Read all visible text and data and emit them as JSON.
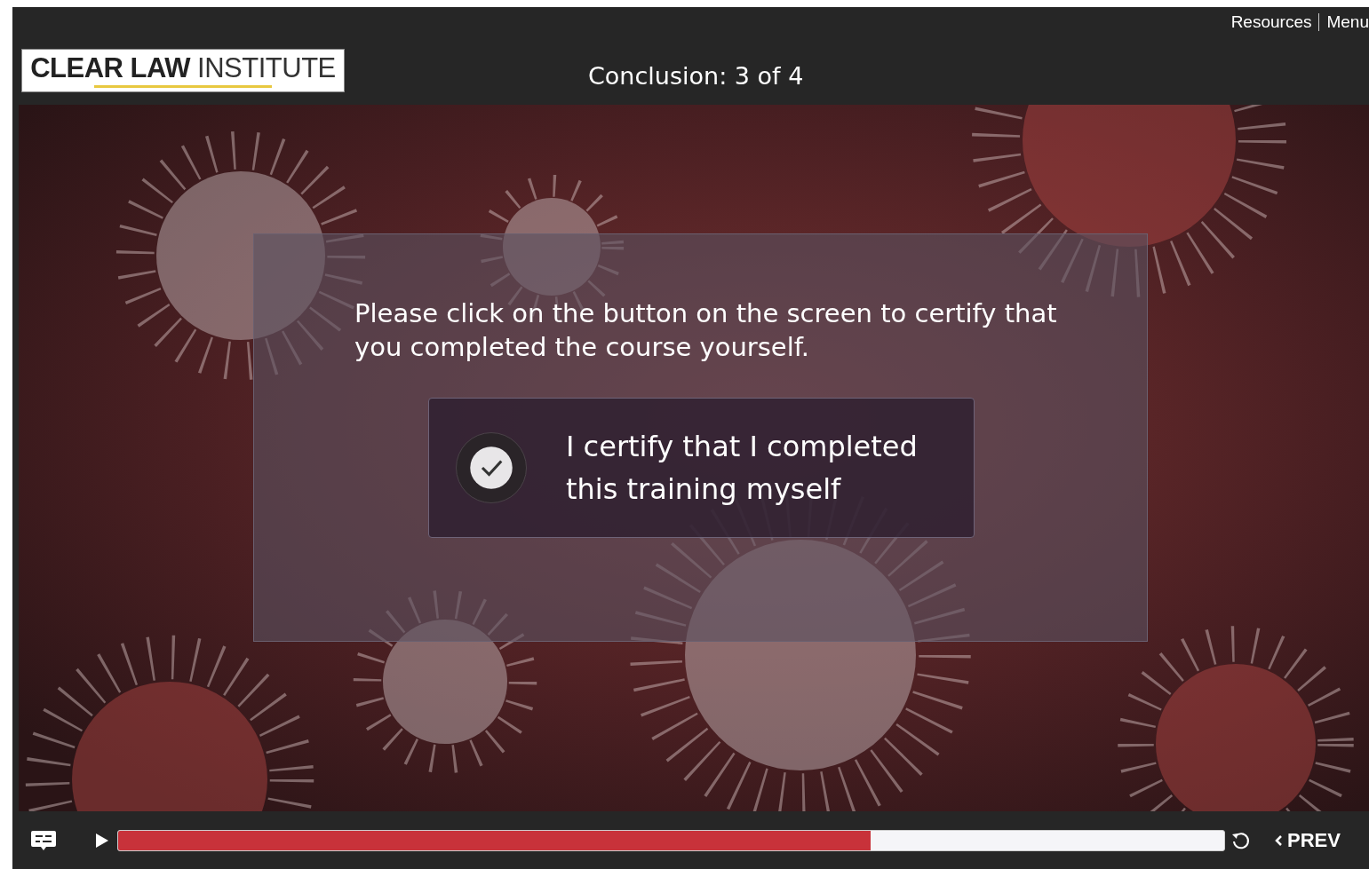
{
  "header": {
    "links": [
      "Resources",
      "Menu"
    ],
    "logo": {
      "bold": "CLEAR LAW",
      "light": "INSTITUTE"
    },
    "title": "Conclusion: 3 of 4"
  },
  "slide": {
    "prompt": "Please click on the button on the screen to certify that you completed the course yourself.",
    "certify_button": {
      "label": "I certify that I completed this training myself",
      "checked": true
    }
  },
  "player": {
    "progress": {
      "level": 0.68
    },
    "prev_label": "PREV"
  }
}
